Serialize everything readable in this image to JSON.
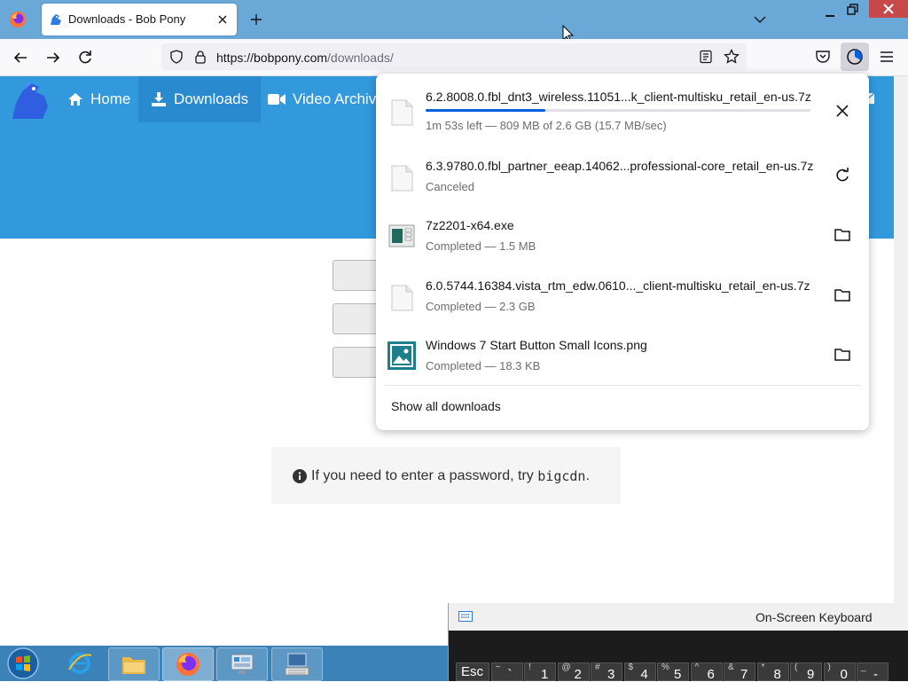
{
  "browser": {
    "tab": {
      "title": "Downloads - Bob Pony"
    },
    "url": {
      "host": "https://bobpony.com",
      "path": "/downloads/"
    }
  },
  "site": {
    "nav": [
      {
        "label": "Home"
      },
      {
        "label": "Downloads"
      },
      {
        "label": "Video Archive"
      }
    ],
    "info": {
      "text": "If you need to enter a password, try",
      "code": "bigcdn",
      "suffix": "."
    }
  },
  "downloads": {
    "items": [
      {
        "name": "6.2.8008.0.fbl_dnt3_wireless.11051...k_client-multisku_retail_en-us.7z",
        "status": "1m 53s left — 809 MB of 2.6 GB (15.7 MB/sec)",
        "progress": 0.31,
        "action": "cancel-icon",
        "file_icon": "generic-file-icon"
      },
      {
        "name": "6.3.9780.0.fbl_partner_eeap.14062...professional-core_retail_en-us.7z",
        "status": "Canceled",
        "action": "retry-icon",
        "file_icon": "generic-file-icon"
      },
      {
        "name": "7z2201-x64.exe",
        "status": "Completed — 1.5 MB",
        "action": "folder-icon",
        "file_icon": "exe-file-icon"
      },
      {
        "name": "6.0.5744.16384.vista_rtm_edw.0610..._client-multisku_retail_en-us.7z",
        "status": "Completed — 2.3 GB",
        "action": "folder-icon",
        "file_icon": "generic-file-icon"
      },
      {
        "name": "Windows 7 Start Button Small Icons.png",
        "status": "Completed — 18.3 KB",
        "action": "folder-icon",
        "file_icon": "image-file-icon"
      }
    ],
    "show_all_label": "Show all downloads",
    "accent_color": "#0060df"
  },
  "osk": {
    "title": "On-Screen Keyboard",
    "keys": [
      {
        "main": "Esc",
        "shift": ""
      },
      {
        "main": "`",
        "shift": "~"
      },
      {
        "main": "1",
        "shift": "!"
      },
      {
        "main": "2",
        "shift": "@"
      },
      {
        "main": "3",
        "shift": "#"
      },
      {
        "main": "4",
        "shift": "$"
      },
      {
        "main": "5",
        "shift": "%"
      },
      {
        "main": "6",
        "shift": "^"
      },
      {
        "main": "7",
        "shift": "&"
      },
      {
        "main": "8",
        "shift": "*"
      },
      {
        "main": "9",
        "shift": "("
      },
      {
        "main": "0",
        "shift": ")"
      },
      {
        "main": "-",
        "shift": "_"
      }
    ]
  },
  "colors": {
    "site_blue": "#3299dc",
    "tabstrip": "#6aa8d8",
    "taskbar": "#3a82b8"
  }
}
